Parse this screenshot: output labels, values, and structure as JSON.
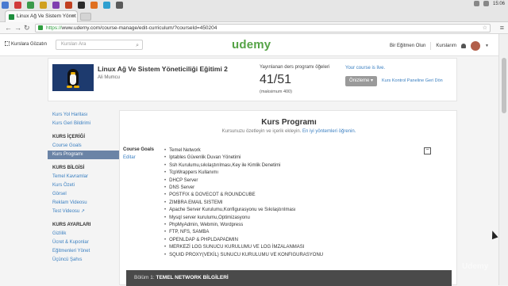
{
  "browser": {
    "tab_title": "Linux Ağ Ve Sistem Yönet",
    "url_scheme": "https://",
    "url_rest": "www.udemy.com/course-manage/edit-curriculum/?courseId=450204",
    "clock": "15:06"
  },
  "header": {
    "browse_label": "Kurslara Gözatın",
    "search_placeholder": "Kursları Ara",
    "logo": "udemy",
    "become_instructor": "Bir Eğitmen Olun",
    "my_courses": "Kurslarım"
  },
  "course": {
    "title": "Linux Ağ Ve Sistem Yöneticiliği Eğitimi 2",
    "author": "Ali Mumcu",
    "published_label": "Yayınlanan ders programı öğeleri",
    "published_count": "41/51",
    "published_max": "(maksimum 400)",
    "live_note": "Your course is live.",
    "preview_label": "Önizleme ▾",
    "back_link": "Kurs Kontrol Paneline Geri Dön"
  },
  "sidebar": {
    "top_items": [
      "Kurs Yol Haritası",
      "Kurs Geri Bildirimi"
    ],
    "content_heading": "KURS İÇERİĞİ",
    "content_items": [
      "Course Goals",
      "Kurs Programı"
    ],
    "info_heading": "KURS BİLGİSİ",
    "info_items": [
      "Temel Kavramlar",
      "Kurs Özeti",
      "Görsel",
      "Reklam Videosu",
      "Test Videosu ↗"
    ],
    "settings_heading": "KURS AYARLARI",
    "settings_items": [
      "Gizlilik",
      "Ücret & Kuponlar",
      "Eğitmenleri Yönet",
      "Üçüncü Şahıs"
    ]
  },
  "main": {
    "title": "Kurs Programı",
    "subtitle": "Kursunuzu özetleyin ve içerik ekleyin.",
    "subtitle_link": "En iyi yöntemleri öğrenin.",
    "goals_label": "Course Goals",
    "goals_edit": "Editar",
    "collapse_symbol": "−",
    "goals": [
      "Temel Network",
      "Iptables Güvenlik Duvarı Yönetimi",
      "Ssh Kurulumu,sıkılaştırılması,Key ile Kimlik Denetimi",
      "TcpWrappers Kullanımı",
      "DHCP Server",
      "DNS Server",
      "POSTFIX & DOVECOT & ROUNDCUBE",
      "ZIMBRA EMAIL SISTEMI",
      "Apache Server Kurulumu,Konfigurasyonu ve Sıkılaştırılması",
      "Mysql server kurulumu,Optimizasyonu",
      "PhpMyAdmin, Webmin, Wordpress",
      "FTP, NFS, SAMBA",
      "OPENLDAP & PHPLDAPADMIN",
      "MERKEZİ LOG SUNUCU KURULUMU VE LOG İMZALANMASI",
      "SQUID PROXY(VEKİL) SUNUCU KURULUMU VE KONFIGURASYONU"
    ],
    "section_prefix": "Bölüm 1:",
    "section_title": "TEMEL NETWORK BİLGİLERİ"
  },
  "colors": {
    "accent": "#55a346",
    "link": "#3a7fc1",
    "active_nav": "#6b84a6"
  },
  "overlay": {
    "watermark": "Udemy"
  }
}
